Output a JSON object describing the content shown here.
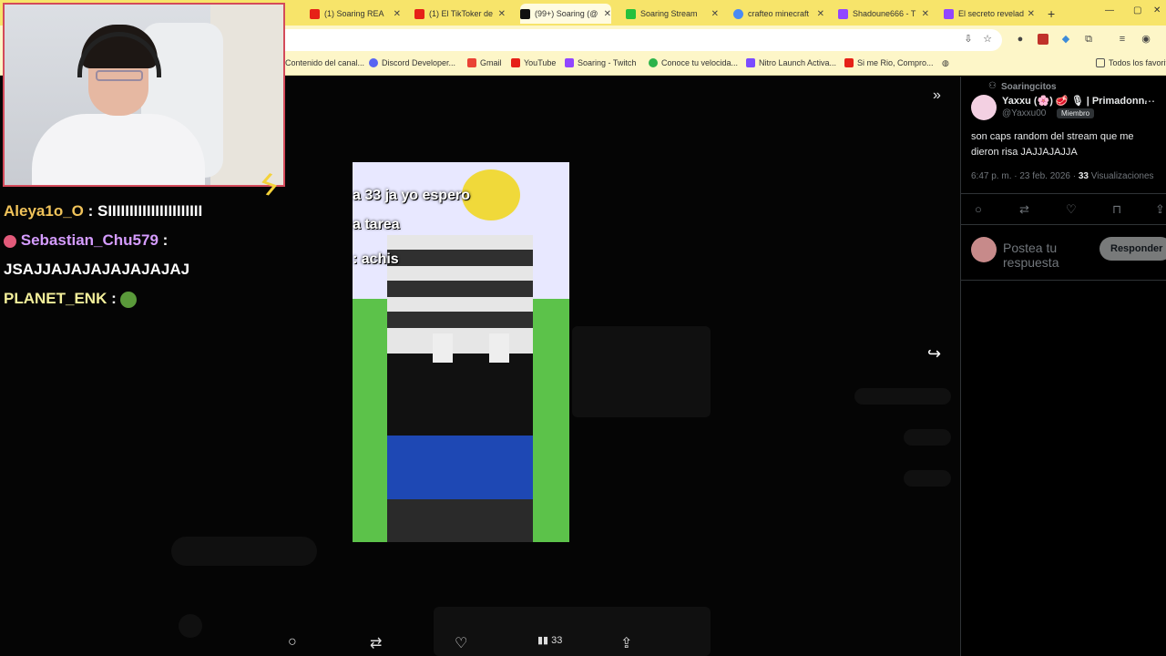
{
  "browser": {
    "tabs": [
      {
        "label": "(1) Soaring REA",
        "icon_color": "#e62117"
      },
      {
        "label": "(1) El TikToker de",
        "icon_color": "#e62117"
      },
      {
        "label": "(99+) Soaring (@",
        "icon_color": "#111111"
      },
      {
        "label": "Soaring Stream",
        "icon_color": "#24c13c"
      },
      {
        "label": "crafteo minecraft",
        "icon_color": "#4a8af4"
      },
      {
        "label": "Shadoune666 - T",
        "icon_color": "#9146ff"
      },
      {
        "label": "El secreto revelad",
        "icon_color": "#9146ff"
      }
    ],
    "new_tab": "+",
    "window_controls": [
      "—",
      "▢",
      "✕"
    ],
    "bookmarks": [
      {
        "label": "Contenido del canal...",
        "icon_color": ""
      },
      {
        "label": "Discord Developer...",
        "icon_color": "#5865f2"
      },
      {
        "label": "Gmail",
        "icon_color": "#ea4335"
      },
      {
        "label": "YouTube",
        "icon_color": "#e62117"
      },
      {
        "label": "Soaring - Twitch",
        "icon_color": "#9146ff"
      },
      {
        "label": "Conoce tu velocida...",
        "icon_color": "#2cb34a"
      },
      {
        "label": "Nitro Launch Activa...",
        "icon_color": "#7b4cff"
      },
      {
        "label": "Si me Rio, Compro...",
        "icon_color": "#e62117"
      }
    ],
    "all_bookmarks": "Todos los favorit"
  },
  "chat": [
    {
      "user": "Aleya1o_O",
      "sep": " : ",
      "message": "SIIIIIIIIIIIIIIIIIIIIII"
    },
    {
      "user": "Sebastian_Chu579",
      "sep": " : ",
      "message": "JSAJJAJAJAJAJAJAJAJ"
    },
    {
      "user": "PLANET_ENK",
      "sep": " : ",
      "message": ""
    }
  ],
  "video": {
    "caption_1": "a 33 ja yo espero",
    "caption_2": "a tarea",
    "caption_3": ": achis"
  },
  "actions": {
    "views": "33"
  },
  "post": {
    "community": "Soaringcitos",
    "author": "Yaxxu (🌸) 🥩 🎙 | Primadonn...",
    "handle": "@Yaxxu00",
    "badge": "Miembro",
    "text": "son caps random del stream que me dieron risa JAJJAJAJJA",
    "time": "6:47 p. m. · 23 feb. 2026 ·",
    "views_count": "33",
    "views_label": " Visualizaciones",
    "reply_placeholder": "Postea tu respuesta",
    "reply_button": "Responder"
  }
}
